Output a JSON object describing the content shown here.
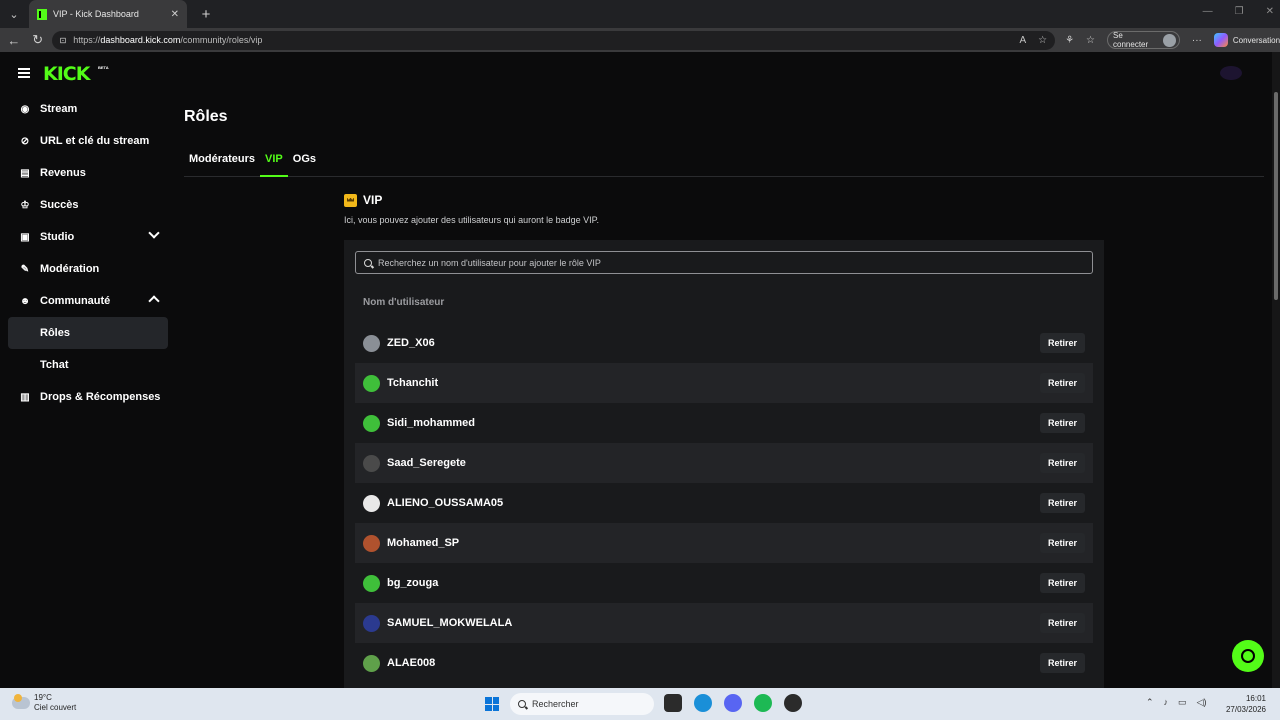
{
  "browser": {
    "tab_title": "VIP - Kick Dashboard",
    "tab_close": "✕",
    "new_tab": "+",
    "url_scheme": "https://",
    "url_host": "dashboard.kick.com",
    "url_path": "/community/roles/vip",
    "signin_label": "Se connecter",
    "conversation_label": "Conversation"
  },
  "brand": {
    "logo": "KICK",
    "beta": "BETA",
    "accent": "#53fc18"
  },
  "sidebar": {
    "items": [
      {
        "label": "Stream",
        "icon": "broadcast-icon"
      },
      {
        "label": "URL et clé du stream",
        "icon": "link-icon"
      },
      {
        "label": "Revenus",
        "icon": "chart-icon"
      },
      {
        "label": "Succès",
        "icon": "trophy-icon"
      },
      {
        "label": "Studio",
        "icon": "studio-icon"
      },
      {
        "label": "Modération",
        "icon": "wrench-icon"
      },
      {
        "label": "Communauté",
        "icon": "users-icon"
      },
      {
        "label": "Rôles"
      },
      {
        "label": "Tchat"
      },
      {
        "label": "Drops & Récompenses",
        "icon": "gift-icon"
      }
    ]
  },
  "main": {
    "title": "Rôles",
    "tabs": [
      "Modérateurs",
      "VIP",
      "OGs"
    ],
    "active_tab": "VIP",
    "section_title": "VIP",
    "section_desc": "Ici, vous pouvez ajouter des utilisateurs qui auront le badge VIP.",
    "search_placeholder": "Recherchez un nom d'utilisateur pour ajouter le rôle VIP",
    "column_header": "Nom d'utilisateur",
    "remove_label": "Retirer",
    "users": [
      {
        "name": "ZED_X06",
        "avatar_color": "#8a8f96"
      },
      {
        "name": "Tchanchit",
        "avatar_color": "#3fbf3a"
      },
      {
        "name": "Sidi_mohammed",
        "avatar_color": "#3fbf3a"
      },
      {
        "name": "Saad_Seregete",
        "avatar_color": "#4a4a4a"
      },
      {
        "name": "ALIENO_OUSSAMA05",
        "avatar_color": "#e8e8e8"
      },
      {
        "name": "Mohamed_SP",
        "avatar_color": "#b0522e"
      },
      {
        "name": "bg_zouga",
        "avatar_color": "#3fbf3a"
      },
      {
        "name": "SAMUEL_MOKWELALA",
        "avatar_color": "#2b3a8f"
      },
      {
        "name": "ALAE008",
        "avatar_color": "#5fa04a"
      }
    ]
  },
  "taskbar": {
    "temperature": "19°C",
    "weather": "Ciel couvert",
    "search_label": "Rechercher",
    "time": "16:01",
    "date": "27/03/2026"
  }
}
